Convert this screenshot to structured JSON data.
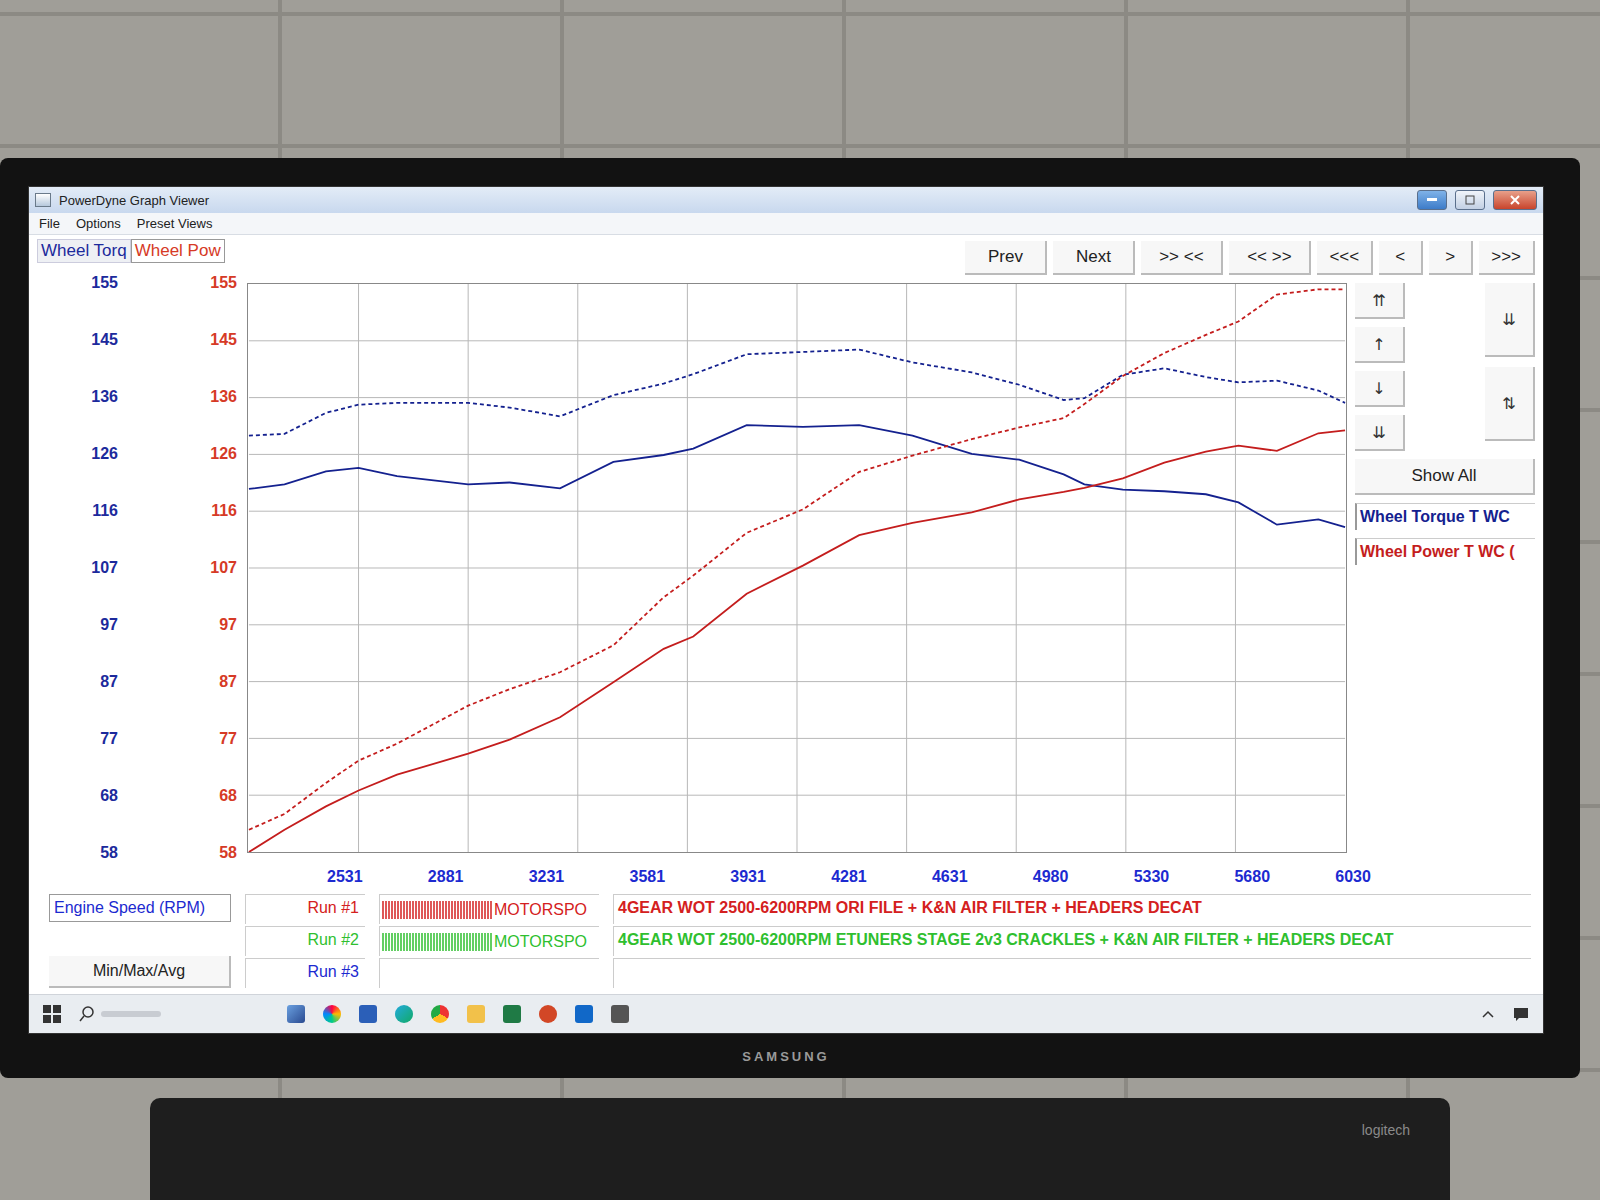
{
  "window": {
    "title": "PowerDyne Graph Viewer"
  },
  "menu": [
    {
      "label": "File"
    },
    {
      "label": "Options"
    },
    {
      "label": "Preset Views"
    }
  ],
  "axis_tabs": [
    {
      "label": "Wheel Torq",
      "selected": false,
      "color": "#1c2a9c"
    },
    {
      "label": "Wheel Pow",
      "selected": true,
      "color": "#d63a26"
    }
  ],
  "toolbar": [
    "Prev",
    "Next",
    ">> <<",
    "<< >>",
    "<<<",
    "<",
    ">",
    ">>>"
  ],
  "chart": {
    "y_ticks_left": [
      "155",
      "145",
      "136",
      "126",
      "116",
      "107",
      "97",
      "87",
      "77",
      "68",
      "58"
    ],
    "y_ticks_right": [
      "155",
      "145",
      "136",
      "126",
      "116",
      "107",
      "97",
      "87",
      "77",
      "68",
      "58"
    ],
    "x_ticks": [
      "2531",
      "2881",
      "3231",
      "3581",
      "3931",
      "4281",
      "4631",
      "4980",
      "5330",
      "5680",
      "6030"
    ],
    "rpm": [
      2500,
      2620,
      2760,
      2870,
      3000,
      3240,
      3380,
      3550,
      3730,
      3900,
      4000,
      4180,
      4370,
      4560,
      4740,
      4940,
      5100,
      5250,
      5320,
      5450,
      5590,
      5730,
      5840,
      5970,
      6110,
      6200
    ],
    "series": [
      {
        "run": "Run #1",
        "kind": "torque",
        "dashed": false,
        "color": "#14218f",
        "values": [
          120,
          120.8,
          123,
          123.6,
          122.2,
          120.8,
          121.1,
          120.1,
          124.6,
          125.8,
          126.9,
          130.9,
          130.6,
          130.9,
          129.1,
          126,
          125,
          122.5,
          120.8,
          119.9,
          119.6,
          119.1,
          117.7,
          113.9,
          114.8,
          113.5
        ]
      },
      {
        "run": "Run #2",
        "kind": "torque",
        "dashed": true,
        "color": "#14218f",
        "values": [
          129.1,
          129.4,
          133,
          134.4,
          134.7,
          134.7,
          133.9,
          132.4,
          136,
          138,
          139.6,
          143,
          143.4,
          143.8,
          141.6,
          139.9,
          137.8,
          135.2,
          135.5,
          139.5,
          140.6,
          139.1,
          138.2,
          138.5,
          136.8,
          134.7
        ]
      },
      {
        "run": "Run #1",
        "kind": "power",
        "dashed": false,
        "color": "#c41d1d",
        "values": [
          58,
          61.8,
          65.8,
          68.5,
          71.2,
          74.8,
          77.2,
          81,
          87,
          92.7,
          94.8,
          102.1,
          106.9,
          112.1,
          114.2,
          116,
          118.2,
          119.5,
          120.2,
          121.8,
          124.5,
          126.4,
          127.4,
          126.5,
          129.5,
          130
        ]
      },
      {
        "run": "Run #2",
        "kind": "power",
        "dashed": true,
        "color": "#c41d1d",
        "values": [
          61.8,
          64.5,
          69.8,
          73.6,
          76.5,
          83,
          85.8,
          88.7,
          93.3,
          101.5,
          105.2,
          112.5,
          116.5,
          122.9,
          125.7,
          128.5,
          130.5,
          132.1,
          134.5,
          139.3,
          143.2,
          146.3,
          148.6,
          153.2,
          154.1,
          154.1
        ]
      }
    ]
  },
  "side_buttons": {
    "left": [
      "⇈",
      "↑",
      "↓",
      "⇊"
    ],
    "right": [
      "⇊",
      "⇅"
    ]
  },
  "show_all": "Show All",
  "legend": [
    {
      "label": "Wheel Torque T WC",
      "color": "#14218f"
    },
    {
      "label": "Wheel Power T WC (",
      "color": "#c41d1d"
    }
  ],
  "footer": {
    "x_axis_label": "Engine Speed (RPM)",
    "stats_button": "Min/Max/Avg",
    "runs": [
      {
        "label": "Run #1",
        "color": "#d42020",
        "name": "MOTORSPO",
        "description": "4GEAR WOT 2500-6200RPM ORI FILE + K&N AIR FILTER + HEADERS DECAT"
      },
      {
        "label": "Run #2",
        "color": "#2fbf2f",
        "name": "MOTORSPO",
        "description": "4GEAR WOT 2500-6200RPM ETUNERS STAGE 2v3 CRACKLES + K&N AIR FILTER + HEADERS DECAT"
      },
      {
        "label": "Run #3",
        "color": "#1c2ad0",
        "name": "",
        "description": ""
      }
    ]
  },
  "monitor": {
    "brand": "SAMSUNG"
  },
  "keyboard": {
    "brand": "logitech"
  }
}
